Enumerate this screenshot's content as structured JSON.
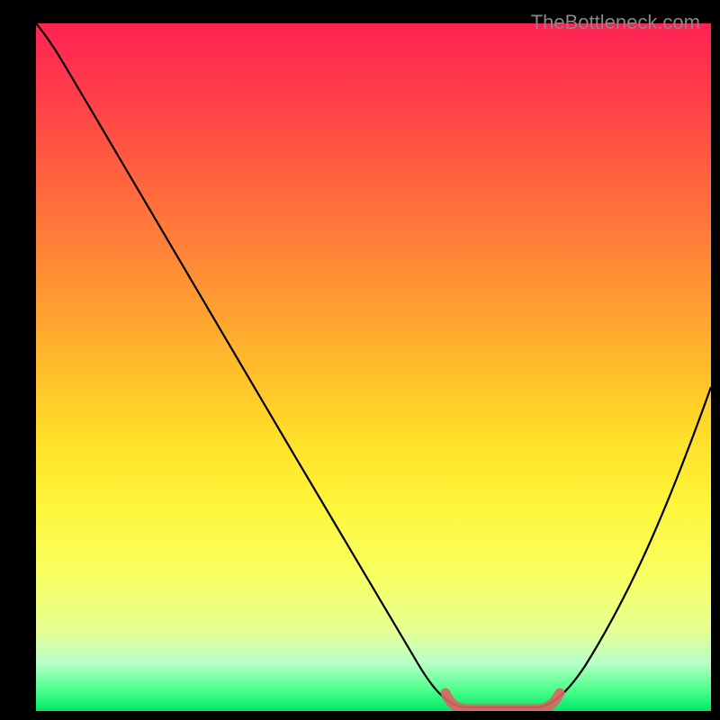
{
  "watermark": "TheBottleneck.com",
  "chart_data": {
    "type": "line",
    "title": "",
    "xlabel": "",
    "ylabel": "",
    "xlim": [
      0,
      100
    ],
    "ylim": [
      0,
      100
    ],
    "series": [
      {
        "name": "bottleneck-curve",
        "x": [
          0,
          4,
          10,
          20,
          30,
          40,
          50,
          57,
          60,
          63,
          70,
          75,
          80,
          85,
          90,
          95,
          100
        ],
        "values": [
          100,
          97,
          90,
          76,
          62,
          48,
          34,
          20,
          10,
          2,
          0,
          0,
          5,
          14,
          25,
          37,
          50
        ]
      }
    ],
    "highlight_region": {
      "x_start": 60,
      "x_end": 76,
      "y": 0
    },
    "gradient_stops": [
      {
        "pos": 0,
        "color": "#ff2254"
      },
      {
        "pos": 50,
        "color": "#ffbc2a"
      },
      {
        "pos": 80,
        "color": "#f8ff60"
      },
      {
        "pos": 100,
        "color": "#00e868"
      }
    ]
  }
}
